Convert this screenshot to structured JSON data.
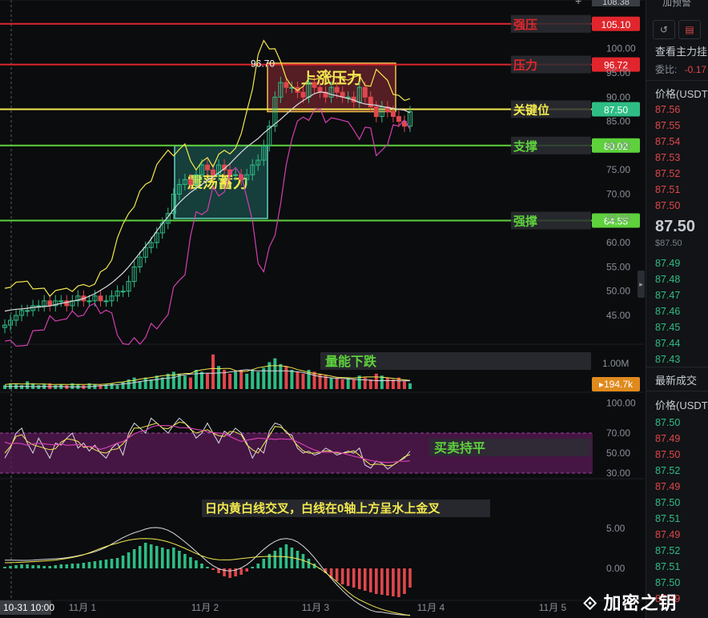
{
  "chart_data": {
    "type": "candlestick",
    "price_axis_ticks": [
      "45.00",
      "50.00",
      "55.00",
      "60.00",
      "65.00",
      "70.00",
      "75.00",
      "80.00",
      "85.00",
      "90.00",
      "95.00",
      "100.00"
    ],
    "price_axis_top": "108.38",
    "volume_axis_ticks": [
      "1.00M"
    ],
    "rsi_axis_ticks": [
      "100.00",
      "70.00",
      "50.00",
      "30.00"
    ],
    "macd_axis_ticks": [
      "5.00",
      "0.00"
    ],
    "time_axis_ticks": [
      "10-31 10:00",
      "11月 1",
      "11月 2",
      "11月 3",
      "11月 4",
      "11月 5"
    ],
    "hlines": [
      {
        "label": "强压",
        "value": 105.1,
        "tag": "105.10",
        "color": "#e0262c"
      },
      {
        "label": "压力",
        "value": 96.72,
        "tag": "96.72",
        "color": "#e0262c"
      },
      {
        "label": "关键位",
        "value": 87.5,
        "tag": "87.50",
        "color": "#f2e94e"
      },
      {
        "label": "支撑",
        "value": 80.02,
        "tag": "80.02",
        "color": "#5ed13c"
      },
      {
        "label": "强撑",
        "value": 64.55,
        "tag": "64.55",
        "color": "#5ed13c"
      }
    ],
    "current_price_tag": "87.50",
    "high_marker": "96.70",
    "zones": [
      {
        "label": "震荡蓄力",
        "from": 65,
        "to": 80,
        "color": "#2a9d8f"
      },
      {
        "label": "上涨压力",
        "from": 87,
        "to": 97,
        "color": "#e0404c"
      }
    ],
    "volume_label": "量能下跌",
    "volume_tag": "194.7k",
    "rsi_label": "买卖持平",
    "macd_label": "日内黄白线交叉，白线在0轴上方呈水上金叉",
    "closes": [
      43,
      44,
      45,
      46,
      46,
      47,
      47,
      48,
      47,
      48,
      48,
      47,
      48,
      49,
      48,
      48,
      49,
      48,
      48,
      49,
      50,
      50,
      52,
      55,
      57,
      59,
      60,
      62,
      64,
      66,
      70,
      72,
      73,
      72,
      74,
      76,
      75,
      74,
      76,
      75,
      74,
      74,
      73,
      74,
      76,
      77,
      80,
      84,
      90,
      93,
      92,
      92,
      91,
      90,
      93,
      92,
      91,
      90,
      92,
      91,
      90,
      90,
      89,
      92,
      90,
      88,
      86,
      88,
      87,
      86,
      85,
      84,
      87
    ],
    "volume_note": "relative volume per bar 0-1",
    "volume": [
      0.1,
      0.15,
      0.12,
      0.1,
      0.2,
      0.15,
      0.1,
      0.12,
      0.15,
      0.1,
      0.12,
      0.1,
      0.15,
      0.12,
      0.1,
      0.15,
      0.12,
      0.1,
      0.12,
      0.15,
      0.1,
      0.18,
      0.25,
      0.3,
      0.2,
      0.3,
      0.25,
      0.35,
      0.3,
      0.4,
      0.45,
      0.4,
      0.35,
      0.3,
      0.5,
      0.45,
      0.4,
      0.9,
      0.6,
      0.5,
      0.4,
      0.45,
      0.5,
      0.4,
      0.5,
      0.45,
      0.55,
      0.7,
      0.8,
      0.65,
      0.6,
      0.5,
      0.45,
      0.4,
      0.5,
      0.45,
      0.4,
      0.35,
      0.3,
      0.3,
      0.25,
      0.3,
      0.25,
      0.35,
      0.3,
      0.25,
      0.4,
      0.35,
      0.3,
      0.25,
      0.3,
      0.2,
      0.15
    ],
    "rsi": [
      45,
      55,
      70,
      75,
      60,
      50,
      65,
      55,
      45,
      60,
      58,
      65,
      70,
      55,
      60,
      52,
      58,
      50,
      45,
      55,
      60,
      48,
      70,
      80,
      75,
      70,
      85,
      80,
      75,
      70,
      78,
      85,
      80,
      75,
      65,
      70,
      80,
      70,
      60,
      72,
      68,
      75,
      70,
      60,
      45,
      55,
      50,
      72,
      80,
      78,
      70,
      68,
      55,
      50,
      52,
      48,
      50,
      55,
      52,
      48,
      50,
      52,
      50,
      55,
      38,
      35,
      42,
      40,
      34,
      38,
      42,
      45,
      52
    ],
    "macd_hist": [
      0.2,
      0.3,
      0.4,
      0.5,
      0.5,
      0.4,
      0.4,
      0.3,
      0.3,
      0.4,
      0.5,
      0.5,
      0.6,
      0.6,
      0.7,
      0.8,
      0.9,
      1.0,
      1.1,
      1.2,
      1.3,
      1.6,
      2.0,
      2.4,
      2.8,
      3.2,
      3.0,
      2.8,
      2.6,
      2.4,
      2.6,
      2.2,
      1.8,
      1.4,
      1.0,
      0.6,
      0.2,
      -0.2,
      -0.6,
      -1.0,
      -1.2,
      -1.0,
      -0.8,
      -0.4,
      0.2,
      0.6,
      1.2,
      1.8,
      2.2,
      2.6,
      3.0,
      2.6,
      2.2,
      1.8,
      1.2,
      0.6,
      0.0,
      -0.6,
      -1.2,
      -1.6,
      -2.0,
      -2.2,
      -2.4,
      -2.6,
      -2.8,
      -3.0,
      -3.2,
      -3.3,
      -3.4,
      -3.5,
      -3.6,
      -3.2,
      -2.4
    ]
  },
  "book": {
    "top_button": "加预警",
    "title": "查看主力挂",
    "ratio_label": "委比:",
    "ratio_value": "-0.17",
    "price_header": "价格(USDT",
    "asks": [
      "87.56",
      "87.55",
      "87.54",
      "87.53",
      "87.52",
      "87.51",
      "87.50"
    ],
    "mid_price": "87.50",
    "mid_sub": "$87.50",
    "bids": [
      "87.49",
      "87.48",
      "87.47",
      "87.46",
      "87.45",
      "87.44",
      "87.43"
    ],
    "trades_title": "最新成交",
    "trades_header": "价格(USDT",
    "trades": [
      {
        "p": "87.50",
        "side": "bid"
      },
      {
        "p": "87.49",
        "side": "ask"
      },
      {
        "p": "87.50",
        "side": "ask"
      },
      {
        "p": "87.52",
        "side": "bid"
      },
      {
        "p": "87.49",
        "side": "ask"
      },
      {
        "p": "87.50",
        "side": "bid"
      },
      {
        "p": "87.51",
        "side": "bid"
      },
      {
        "p": "87.49",
        "side": "ask"
      },
      {
        "p": "87.52",
        "side": "bid"
      },
      {
        "p": "87.51",
        "side": "bid"
      },
      {
        "p": "87.50",
        "side": "bid"
      },
      {
        "p": "87.49",
        "side": "ask"
      }
    ]
  },
  "watermark": "加密之钥",
  "colors": {
    "up": "#2ebd85",
    "down": "#e0474c",
    "yellow_line": "#f2e94e",
    "white_line": "#d9dbe0",
    "pink_line": "#d23fb0",
    "purple_band": "#5a1a55"
  }
}
